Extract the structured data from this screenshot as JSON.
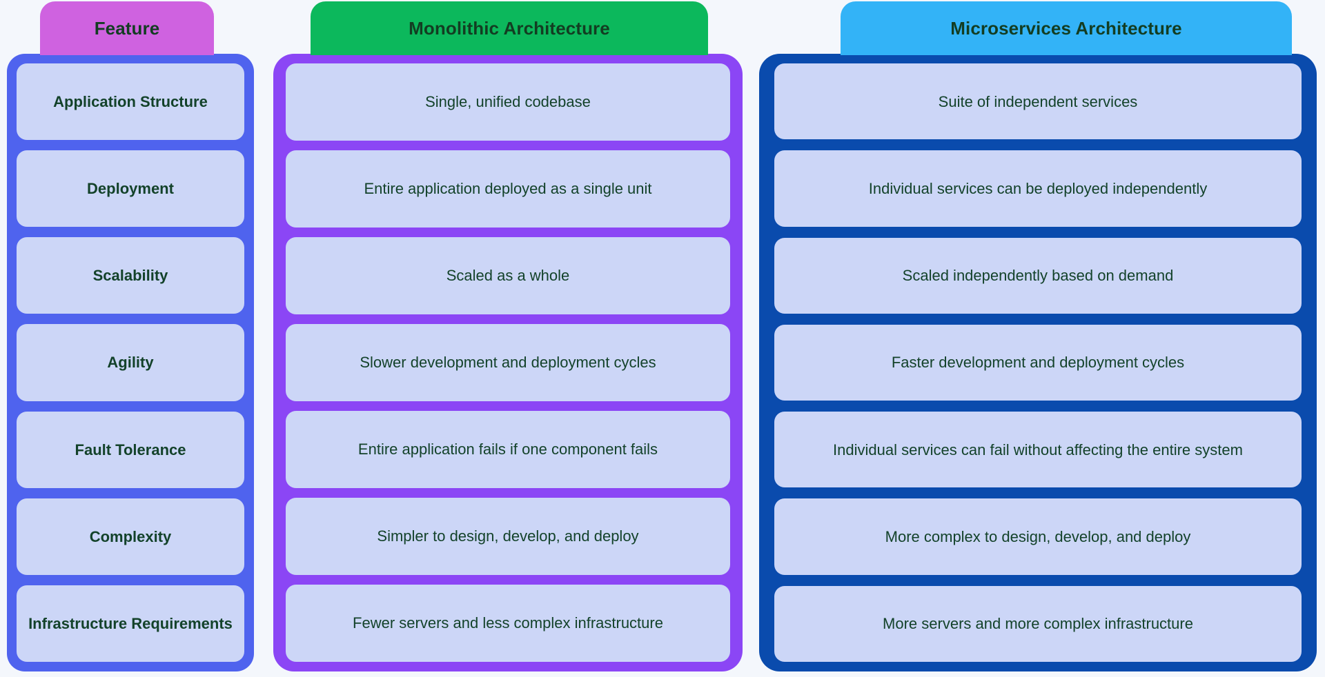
{
  "background_color": "#f4f7fc",
  "text_color": "#13422a",
  "cell_background": "#ccd6f7",
  "columns": [
    {
      "id": "feature",
      "header": "Feature",
      "header_color": "#cf62e0",
      "container_color": "#4f63ee",
      "cells": [
        "Application Structure",
        "Deployment",
        "Scalability",
        "Agility",
        "Fault Tolerance",
        "Complexity",
        "Infrastructure Requirements"
      ]
    },
    {
      "id": "monolithic",
      "header": "Monolithic Architecture",
      "header_color": "#0cb85c",
      "container_color": "#8b46f5",
      "cells": [
        "Single, unified codebase",
        "Entire application deployed as a single unit",
        "Scaled as a whole",
        "Slower development and deployment cycles",
        "Entire application fails if one component fails",
        "Simpler to design, develop, and deploy",
        "Fewer servers and less complex infrastructure"
      ]
    },
    {
      "id": "microservices",
      "header": "Microservices Architecture",
      "header_color": "#33b3f7",
      "container_color": "#0a4bad",
      "cells": [
        "Suite of independent services",
        "Individual services can be deployed independently",
        "Scaled independently based on demand",
        "Faster development and deployment cycles",
        "Individual services can fail without affecting the entire system",
        "More complex to design, develop, and deploy",
        "More servers and more complex infrastructure"
      ]
    }
  ]
}
